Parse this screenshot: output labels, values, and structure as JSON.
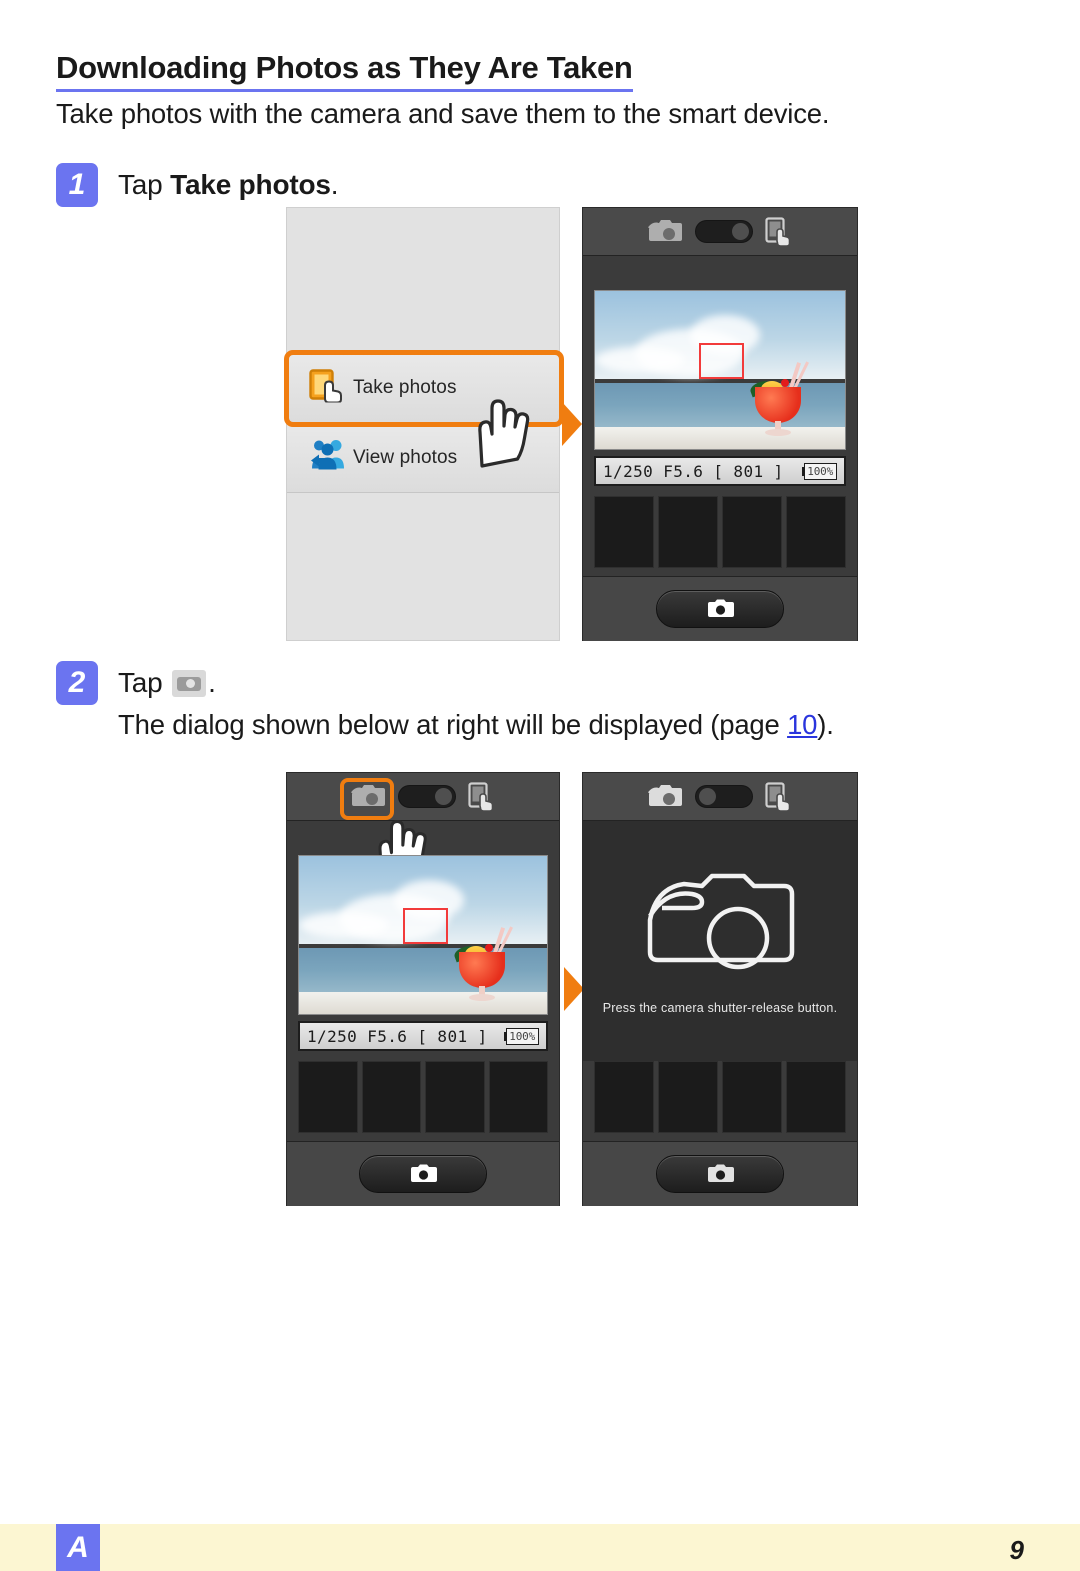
{
  "document": {
    "title": "Downloading Photos as They Are Taken",
    "intro": "Take photos with the camera and save them to the smart device."
  },
  "steps": [
    {
      "number": "1",
      "lead": "Tap ",
      "target": "Take photos",
      "trailing": "."
    },
    {
      "number": "2",
      "lead": "Tap ",
      "icon": "camera-icon",
      "trailing": ".",
      "detail_before": "The dialog shown below at right will be displayed (page ",
      "detail_link": "10",
      "detail_after": ")."
    }
  ],
  "figure_row_1": {
    "menu_screen": {
      "items": [
        {
          "label": "Take photos",
          "icon": "take-photos-icon",
          "highlighted": "true"
        },
        {
          "label": "View photos",
          "icon": "view-photos-icon",
          "highlighted": "false"
        }
      ],
      "hand_cursor": "tap-hand-cursor"
    },
    "arrow": "orange-arrow-right",
    "camera_screen": {
      "topbar": {
        "camera_icon": "remote-camera-icon",
        "toggle": "mode-toggle",
        "toggle_state": "right",
        "device_icon": "smart-device-icon"
      },
      "exposure": "1/250   F5.6   [ 801 ]",
      "battery": "100%",
      "shutter_button": "shutter-release-button",
      "thumbnails": [
        "",
        "",
        "",
        ""
      ]
    }
  },
  "figure_row_2": {
    "camera_screen": {
      "topbar": {
        "camera_icon": "remote-camera-icon",
        "toggle": "mode-toggle",
        "toggle_state": "right",
        "device_icon": "smart-device-icon",
        "highlighted": "camera-icon"
      },
      "exposure": "1/250   F5.6   [ 801 ]",
      "battery": "100%",
      "shutter_button": "shutter-release-button",
      "hand_cursor": "tap-hand-cursor",
      "thumbnails": [
        "",
        "",
        "",
        ""
      ]
    },
    "arrow": "orange-arrow-right",
    "dialog_screen": {
      "topbar": {
        "camera_icon": "remote-camera-icon",
        "toggle": "mode-toggle",
        "toggle_state": "left",
        "device_icon": "smart-device-icon"
      },
      "dialog_icon": "camera-outline-icon",
      "dialog_text": "Press the camera shutter-release button.",
      "shutter_button": "shutter-release-button",
      "thumbnails": [
        "",
        "",
        "",
        ""
      ]
    }
  },
  "footer": {
    "badge": "A",
    "page_number": "9"
  },
  "colors": {
    "accent_blue": "#6b74f0",
    "accent_orange": "#f07d10",
    "footer_band": "#fcf6d2",
    "link": "#2a35dd",
    "af_box": "#f23b3b"
  }
}
